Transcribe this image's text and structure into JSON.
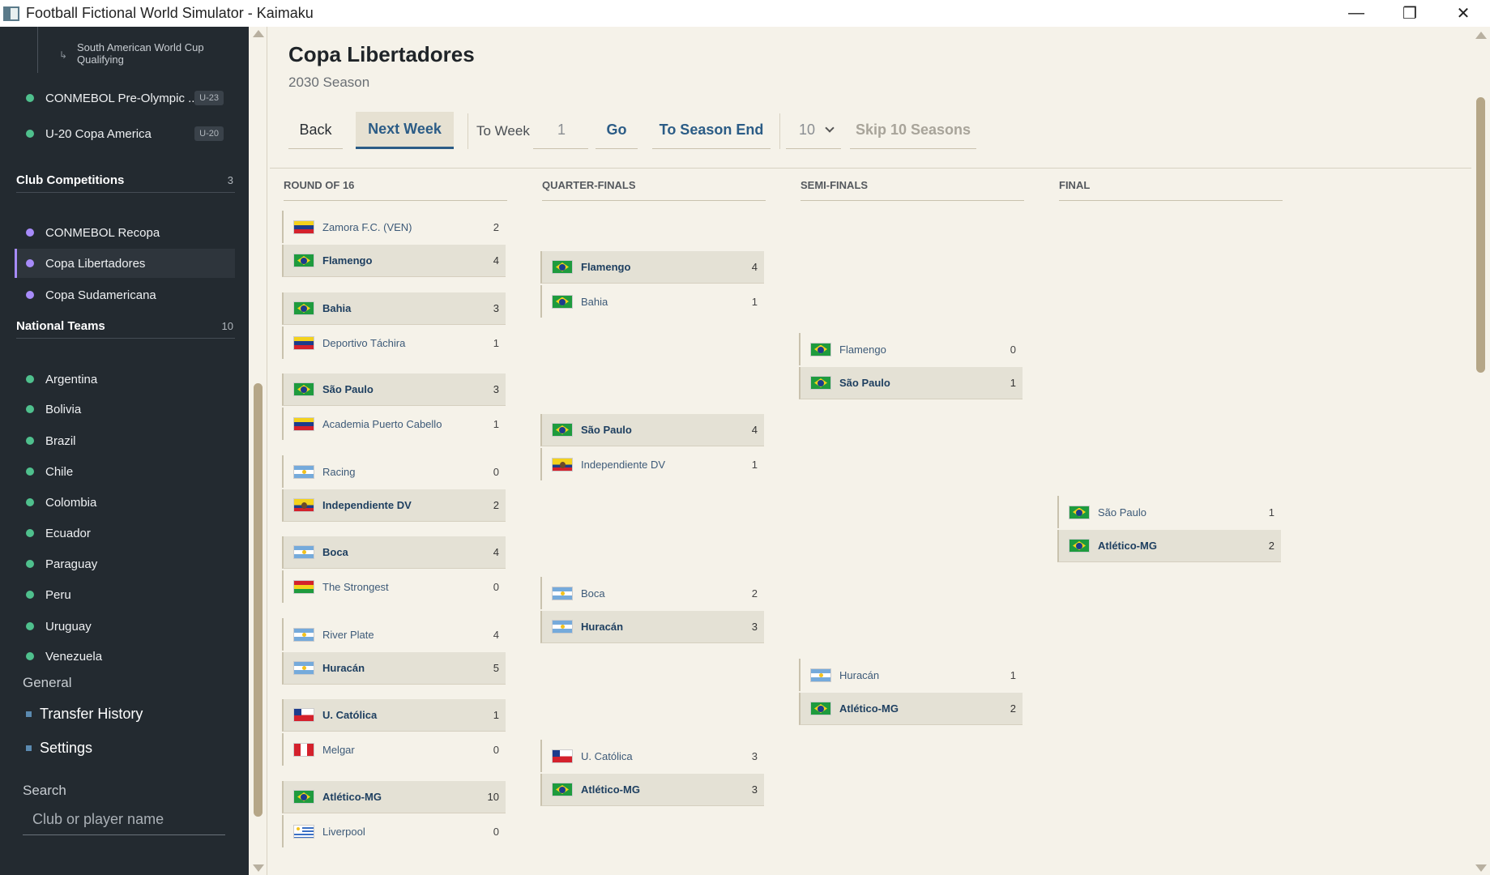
{
  "window": {
    "title": "Football Fictional World Simulator - Kaimaku"
  },
  "sidebar": {
    "sub_item": "South American World Cup Qualifying",
    "top_items": [
      {
        "label": "CONMEBOL Pre-Olympic ...",
        "badge": "U-23"
      },
      {
        "label": "U-20 Copa America",
        "badge": "U-20"
      }
    ],
    "club_section": {
      "title": "Club Competitions",
      "count": "3"
    },
    "club_items": [
      {
        "label": "CONMEBOL Recopa"
      },
      {
        "label": "Copa Libertadores"
      },
      {
        "label": "Copa Sudamericana"
      }
    ],
    "national_section": {
      "title": "National Teams",
      "count": "10"
    },
    "national_items": [
      {
        "label": "Argentina"
      },
      {
        "label": "Bolivia"
      },
      {
        "label": "Brazil"
      },
      {
        "label": "Chile"
      },
      {
        "label": "Colombia"
      },
      {
        "label": "Ecuador"
      },
      {
        "label": "Paraguay"
      },
      {
        "label": "Peru"
      },
      {
        "label": "Uruguay"
      },
      {
        "label": "Venezuela"
      }
    ],
    "general_label": "General",
    "transfer_history": "Transfer History",
    "settings": "Settings",
    "search_label": "Search",
    "search_placeholder": "Club or player name"
  },
  "main": {
    "title": "Copa Libertadores",
    "subtitle": "2030 Season",
    "toolbar": {
      "back": "Back",
      "next_week": "Next Week",
      "to_week_label": "To Week",
      "to_week_value": "1",
      "go": "Go",
      "to_season_end": "To Season End",
      "skip_count": "10",
      "skip_label": "Skip 10 Seasons"
    }
  },
  "bracket": {
    "rounds": [
      "ROUND OF 16",
      "QUARTER-FINALS",
      "SEMI-FINALS",
      "FINAL"
    ],
    "round_of_16": [
      [
        {
          "name": "Zamora F.C. (VEN)",
          "flag": "ve",
          "score": "2",
          "win": false
        },
        {
          "name": "Flamengo",
          "flag": "br",
          "score": "4",
          "win": true
        }
      ],
      [
        {
          "name": "Bahia",
          "flag": "br",
          "score": "3",
          "win": true
        },
        {
          "name": "Deportivo Táchira",
          "flag": "ve",
          "score": "1",
          "win": false
        }
      ],
      [
        {
          "name": "São Paulo",
          "flag": "br",
          "score": "3",
          "win": true
        },
        {
          "name": "Academia Puerto Cabello",
          "flag": "ve",
          "score": "1",
          "win": false
        }
      ],
      [
        {
          "name": "Racing",
          "flag": "ar",
          "score": "0",
          "win": false
        },
        {
          "name": "Independiente DV",
          "flag": "ec",
          "score": "2",
          "win": true
        }
      ],
      [
        {
          "name": "Boca",
          "flag": "ar",
          "score": "4",
          "win": true
        },
        {
          "name": "The Strongest",
          "flag": "bo",
          "score": "0",
          "win": false
        }
      ],
      [
        {
          "name": "River Plate",
          "flag": "ar",
          "score": "4",
          "win": false
        },
        {
          "name": "Huracán",
          "flag": "ar",
          "score": "5",
          "win": true
        }
      ],
      [
        {
          "name": "U. Católica",
          "flag": "cl",
          "score": "1",
          "win": true
        },
        {
          "name": "Melgar",
          "flag": "pe",
          "score": "0",
          "win": false
        }
      ],
      [
        {
          "name": "Atlético-MG",
          "flag": "br",
          "score": "10",
          "win": true
        },
        {
          "name": "Liverpool",
          "flag": "uy",
          "score": "0",
          "win": false
        }
      ]
    ],
    "quarter_finals": [
      [
        {
          "name": "Flamengo",
          "flag": "br",
          "score": "4",
          "win": true
        },
        {
          "name": "Bahia",
          "flag": "br",
          "score": "1",
          "win": false
        }
      ],
      [
        {
          "name": "São Paulo",
          "flag": "br",
          "score": "4",
          "win": true
        },
        {
          "name": "Independiente DV",
          "flag": "ec",
          "score": "1",
          "win": false
        }
      ],
      [
        {
          "name": "Boca",
          "flag": "ar",
          "score": "2",
          "win": false
        },
        {
          "name": "Huracán",
          "flag": "ar",
          "score": "3",
          "win": true
        }
      ],
      [
        {
          "name": "U. Católica",
          "flag": "cl",
          "score": "3",
          "win": false
        },
        {
          "name": "Atlético-MG",
          "flag": "br",
          "score": "3",
          "win": true
        }
      ]
    ],
    "semi_finals": [
      [
        {
          "name": "Flamengo",
          "flag": "br",
          "score": "0",
          "win": false
        },
        {
          "name": "São Paulo",
          "flag": "br",
          "score": "1",
          "win": true
        }
      ],
      [
        {
          "name": "Huracán",
          "flag": "ar",
          "score": "1",
          "win": false
        },
        {
          "name": "Atlético-MG",
          "flag": "br",
          "score": "2",
          "win": true
        }
      ]
    ],
    "final": [
      [
        {
          "name": "São Paulo",
          "flag": "br",
          "score": "1",
          "win": false
        },
        {
          "name": "Atlético-MG",
          "flag": "br",
          "score": "2",
          "win": true
        }
      ]
    ]
  }
}
